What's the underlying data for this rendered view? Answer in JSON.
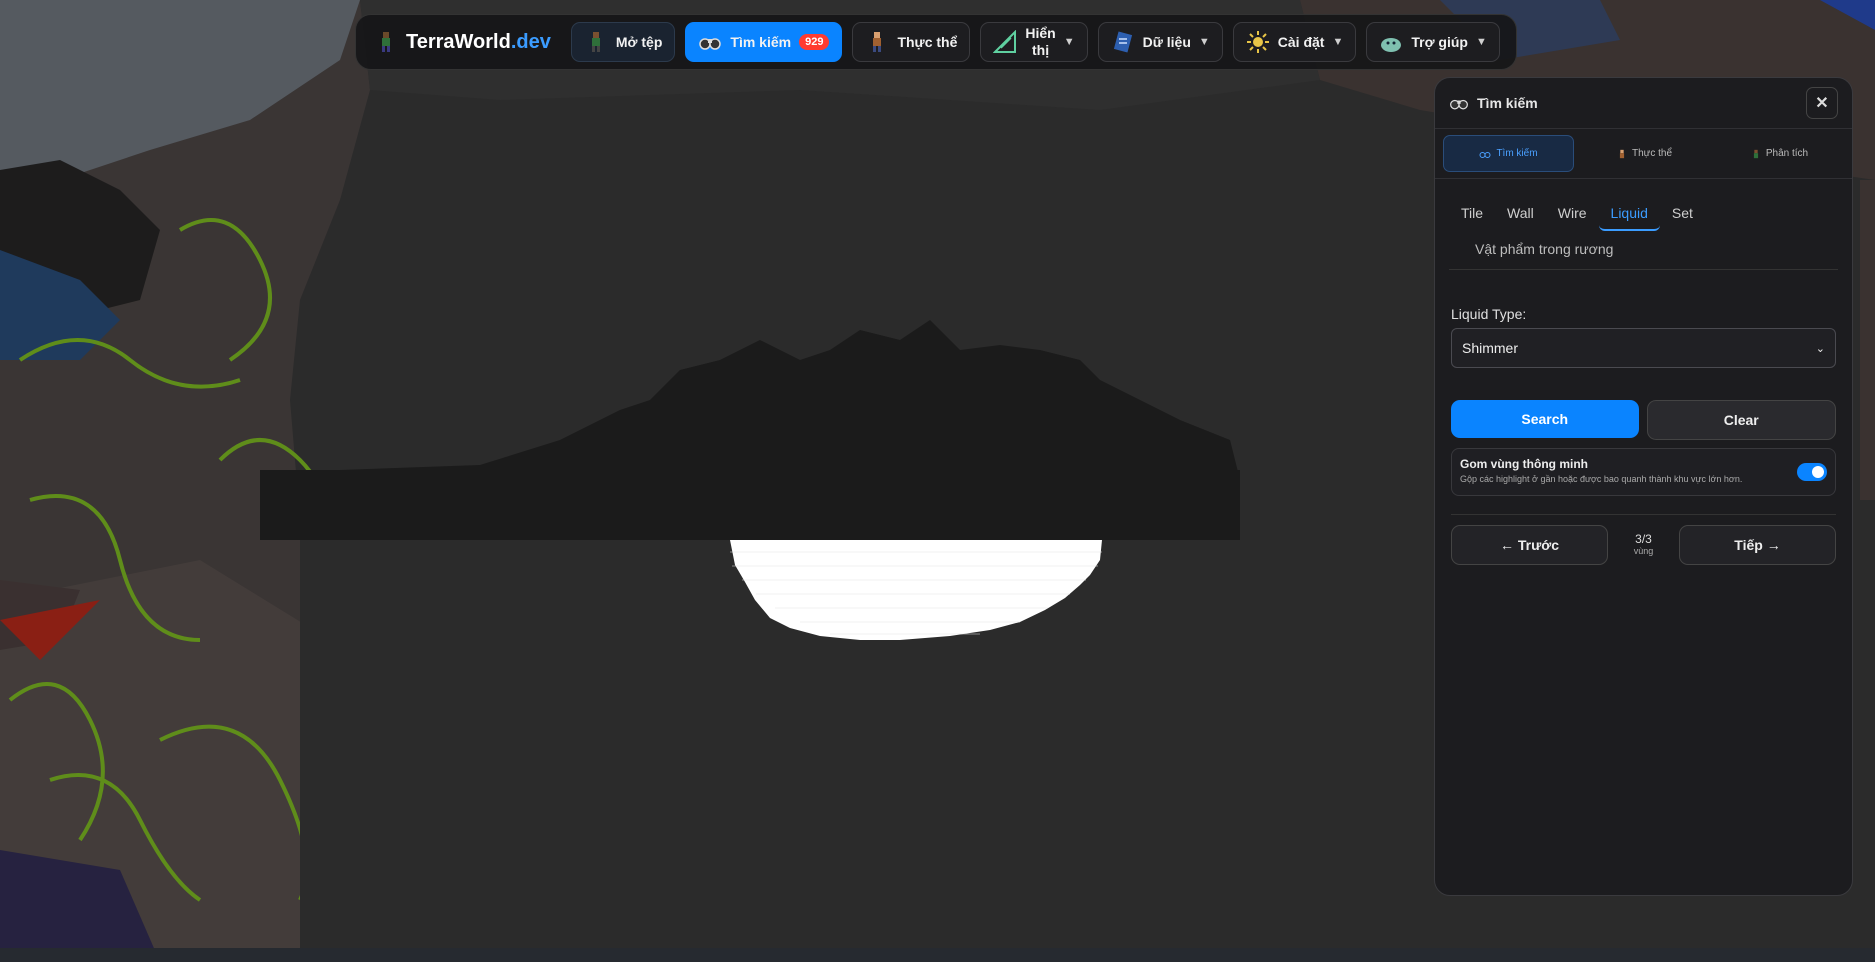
{
  "brand": {
    "name": "TerraWorld",
    "suffix": ".dev"
  },
  "toolbar": {
    "open_file": "Mở tệp",
    "search": "Tìm kiếm",
    "search_count": "929",
    "entities": "Thực thể",
    "display_line1": "Hiển",
    "display_line2": "thị",
    "data": "Dữ liệu",
    "settings": "Cài đặt",
    "help": "Trợ giúp"
  },
  "panel": {
    "title": "Tìm kiếm",
    "tabs": [
      {
        "label": "Tìm kiếm"
      },
      {
        "label": "Thực thể"
      },
      {
        "label": "Phân tích"
      }
    ],
    "subtabs": [
      "Tile",
      "Wall",
      "Wire",
      "Liquid",
      "Set"
    ],
    "subtab_extra": "Vật phẩm trong rương",
    "liquid_type_label": "Liquid Type:",
    "liquid_type_value": "Shimmer",
    "search_button": "Search",
    "clear_button": "Clear",
    "smart_title": "Gom vùng thông minh",
    "smart_desc": "Gộp các highlight ở gần hoặc được bao quanh thành khu vực lớn hơn.",
    "smart_enabled": true,
    "prev_button": "← Trước",
    "next_button": "Tiếp →",
    "pager_count": "3/3",
    "pager_unit": "vùng"
  },
  "colors": {
    "accent": "#0a84ff",
    "badge": "#ff3b30",
    "highlight": "#ffffff"
  }
}
